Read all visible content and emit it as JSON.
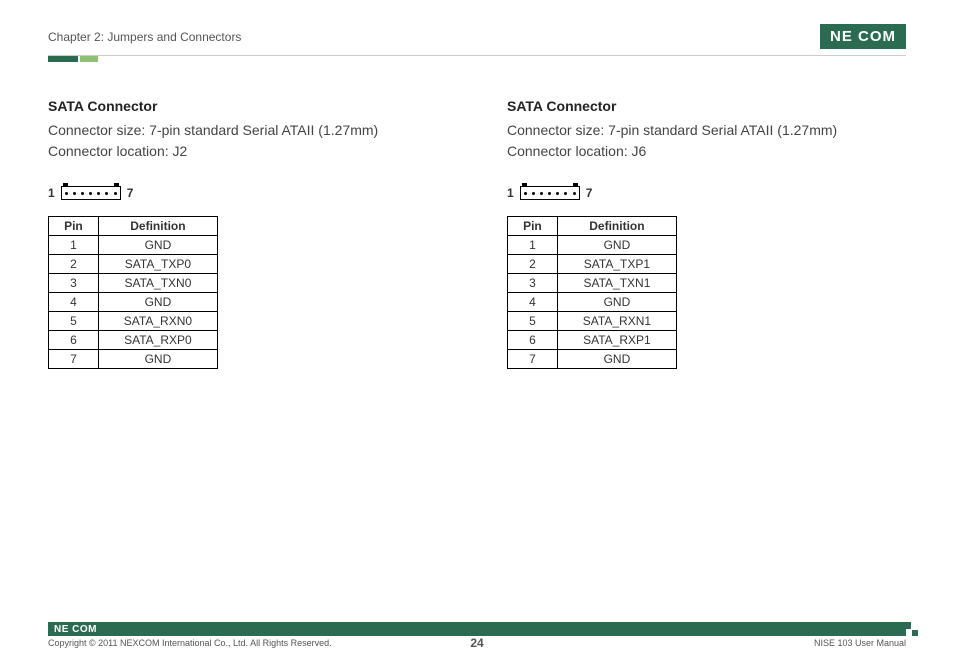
{
  "header": {
    "chapter": "Chapter 2: Jumpers and Connectors",
    "brand": "NE COM"
  },
  "sections": [
    {
      "title": "SATA Connector",
      "size": "Connector size: 7-pin standard Serial ATAII (1.27mm)",
      "location": "Connector location: J2",
      "fig_left": "1",
      "fig_right": "7",
      "table": {
        "headers": [
          "Pin",
          "Definition"
        ],
        "rows": [
          [
            "1",
            "GND"
          ],
          [
            "2",
            "SATA_TXP0"
          ],
          [
            "3",
            "SATA_TXN0"
          ],
          [
            "4",
            "GND"
          ],
          [
            "5",
            "SATA_RXN0"
          ],
          [
            "6",
            "SATA_RXP0"
          ],
          [
            "7",
            "GND"
          ]
        ]
      }
    },
    {
      "title": "SATA Connector",
      "size": "Connector size: 7-pin standard Serial ATAII (1.27mm)",
      "location": "Connector location: J6",
      "fig_left": "1",
      "fig_right": "7",
      "table": {
        "headers": [
          "Pin",
          "Definition"
        ],
        "rows": [
          [
            "1",
            "GND"
          ],
          [
            "2",
            "SATA_TXP1"
          ],
          [
            "3",
            "SATA_TXN1"
          ],
          [
            "4",
            "GND"
          ],
          [
            "5",
            "SATA_RXN1"
          ],
          [
            "6",
            "SATA_RXP1"
          ],
          [
            "7",
            "GND"
          ]
        ]
      }
    }
  ],
  "footer": {
    "brand": "NE COM",
    "copyright": "Copyright © 2011 NEXCOM International Co., Ltd. All Rights Reserved.",
    "page": "24",
    "manual": "NISE 103 User Manual"
  }
}
